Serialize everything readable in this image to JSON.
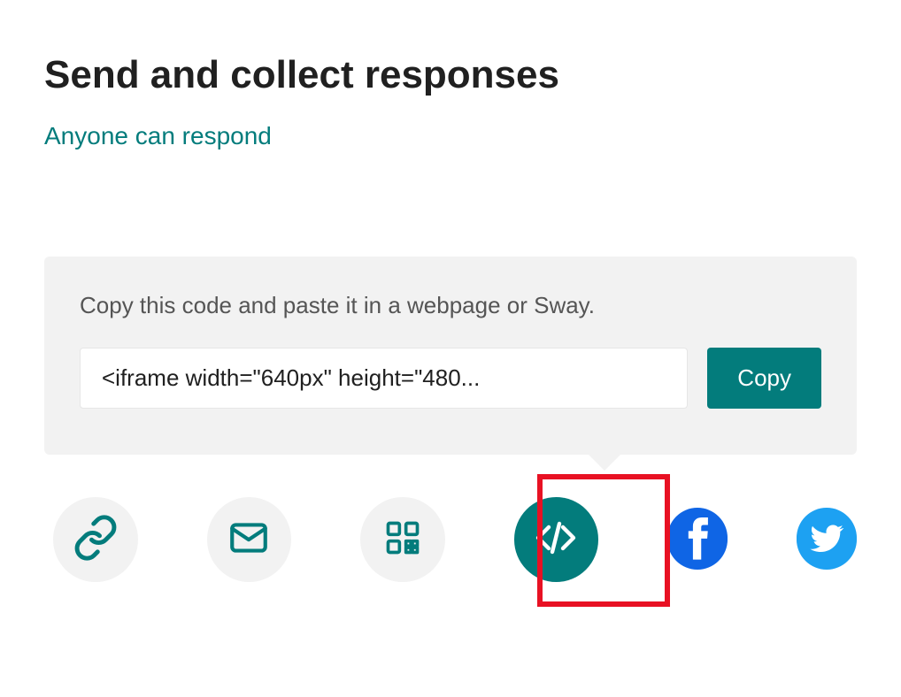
{
  "colors": {
    "teal": "#037c7c",
    "highlight": "#e81123",
    "facebook": "#0f65e5",
    "twitter": "#1da1f2"
  },
  "header": {
    "title": "Send and collect responses",
    "subtitle": "Anyone can respond"
  },
  "panel": {
    "description": "Copy this code and paste it in a webpage or Sway.",
    "code_value": "<iframe width=\"640px\" height=\"480...",
    "copy_label": "Copy"
  },
  "share_options": {
    "link": "link-icon",
    "email": "email-icon",
    "qrcode": "qrcode-icon",
    "embed": "embed-icon",
    "facebook": "facebook-icon",
    "twitter": "twitter-icon",
    "selected": "embed"
  }
}
